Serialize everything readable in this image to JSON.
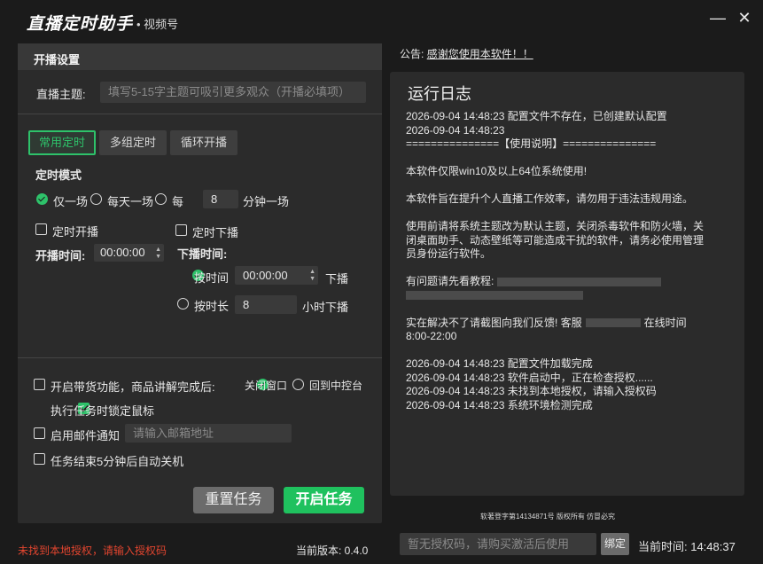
{
  "app": {
    "title": "直播定时助手",
    "subtitle": "• 视频号"
  },
  "window": {
    "minimize": "—",
    "close": "✕"
  },
  "panel": {
    "header": "开播设置",
    "topic_label": "直播主题:",
    "topic_placeholder": "填写5-15字主题可吸引更多观众（开播必填项）",
    "tabs": [
      "常用定时",
      "多组定时",
      "循环开播"
    ],
    "mode_title": "定时模式",
    "mode_once": "仅一场",
    "mode_daily": "每天一场",
    "mode_every": "每",
    "mode_every_value": "8",
    "mode_every_unit": "分钟一场",
    "start_check": "定时开播",
    "start_time_label": "开播时间:",
    "start_time_value": "00:00:00",
    "end_check": "定时下播",
    "end_time_title": "下播时间:",
    "end_by_time": "按时间",
    "end_by_time_value": "00:00:00",
    "end_by_time_suffix": "下播",
    "end_by_duration": "按时长",
    "end_by_duration_value": "8",
    "end_by_duration_suffix": "小时下播",
    "opt_goods": "开启带货功能，商品讲解完成后:",
    "opt_close_window": "关闭窗口",
    "opt_back_console": "回到中控台",
    "opt_lock_mouse": "执行任务时锁定鼠标",
    "opt_mail": "启用邮件通知",
    "opt_mail_placeholder": "请输入邮箱地址",
    "opt_shutdown": "任务结束5分钟后自动关机",
    "btn_reset": "重置任务",
    "btn_start": "开启任务"
  },
  "notice": {
    "label": "公告:",
    "text": "感谢您使用本软件！！"
  },
  "log": {
    "title": "运行日志",
    "line1": "2026-09-04 14:48:23 配置文件不存在，已创建默认配置",
    "line2": "2026-09-04 14:48:23",
    "line3": "===============【使用说明】===============",
    "p1": "本软件仅限win10及以上64位系统使用!",
    "p2": "本软件旨在提升个人直播工作效率，请勿用于违法违规用途。",
    "p3": "使用前请将系统主题改为默认主题，关闭杀毒软件和防火墙，关闭桌面助手、动态壁纸等可能造成干扰的软件，请务必使用管理员身份运行软件。",
    "p4": "有问题请先看教程:",
    "p5a": "实在解决不了请截图向我们反馈! 客服",
    "p5b": "在线时间",
    "p5c": "8:00-22:00",
    "l1": "2026-09-04 14:48:23 配置文件加载完成",
    "l2": "2026-09-04 14:48:23 软件启动中，正在检查授权......",
    "l3": "2026-09-04 14:48:23 未找到本地授权，请输入授权码",
    "l4": "2026-09-04 14:48:23 系统环境检测完成"
  },
  "footer": {
    "copyright": "软著登字第14134871号 版权所有 仿冒必究",
    "status": "未找到本地授权，请输入授权码",
    "version": "当前版本: 0.4.0",
    "auth_placeholder": "暂无授权码，请购买激活后使用",
    "bind": "绑定",
    "time": "当前时间:  14:48:37"
  },
  "colors": {
    "accent": "#2ec26a",
    "error": "#e2452f",
    "bg": "#1b1b1b",
    "panel": "#2b2b2b"
  }
}
